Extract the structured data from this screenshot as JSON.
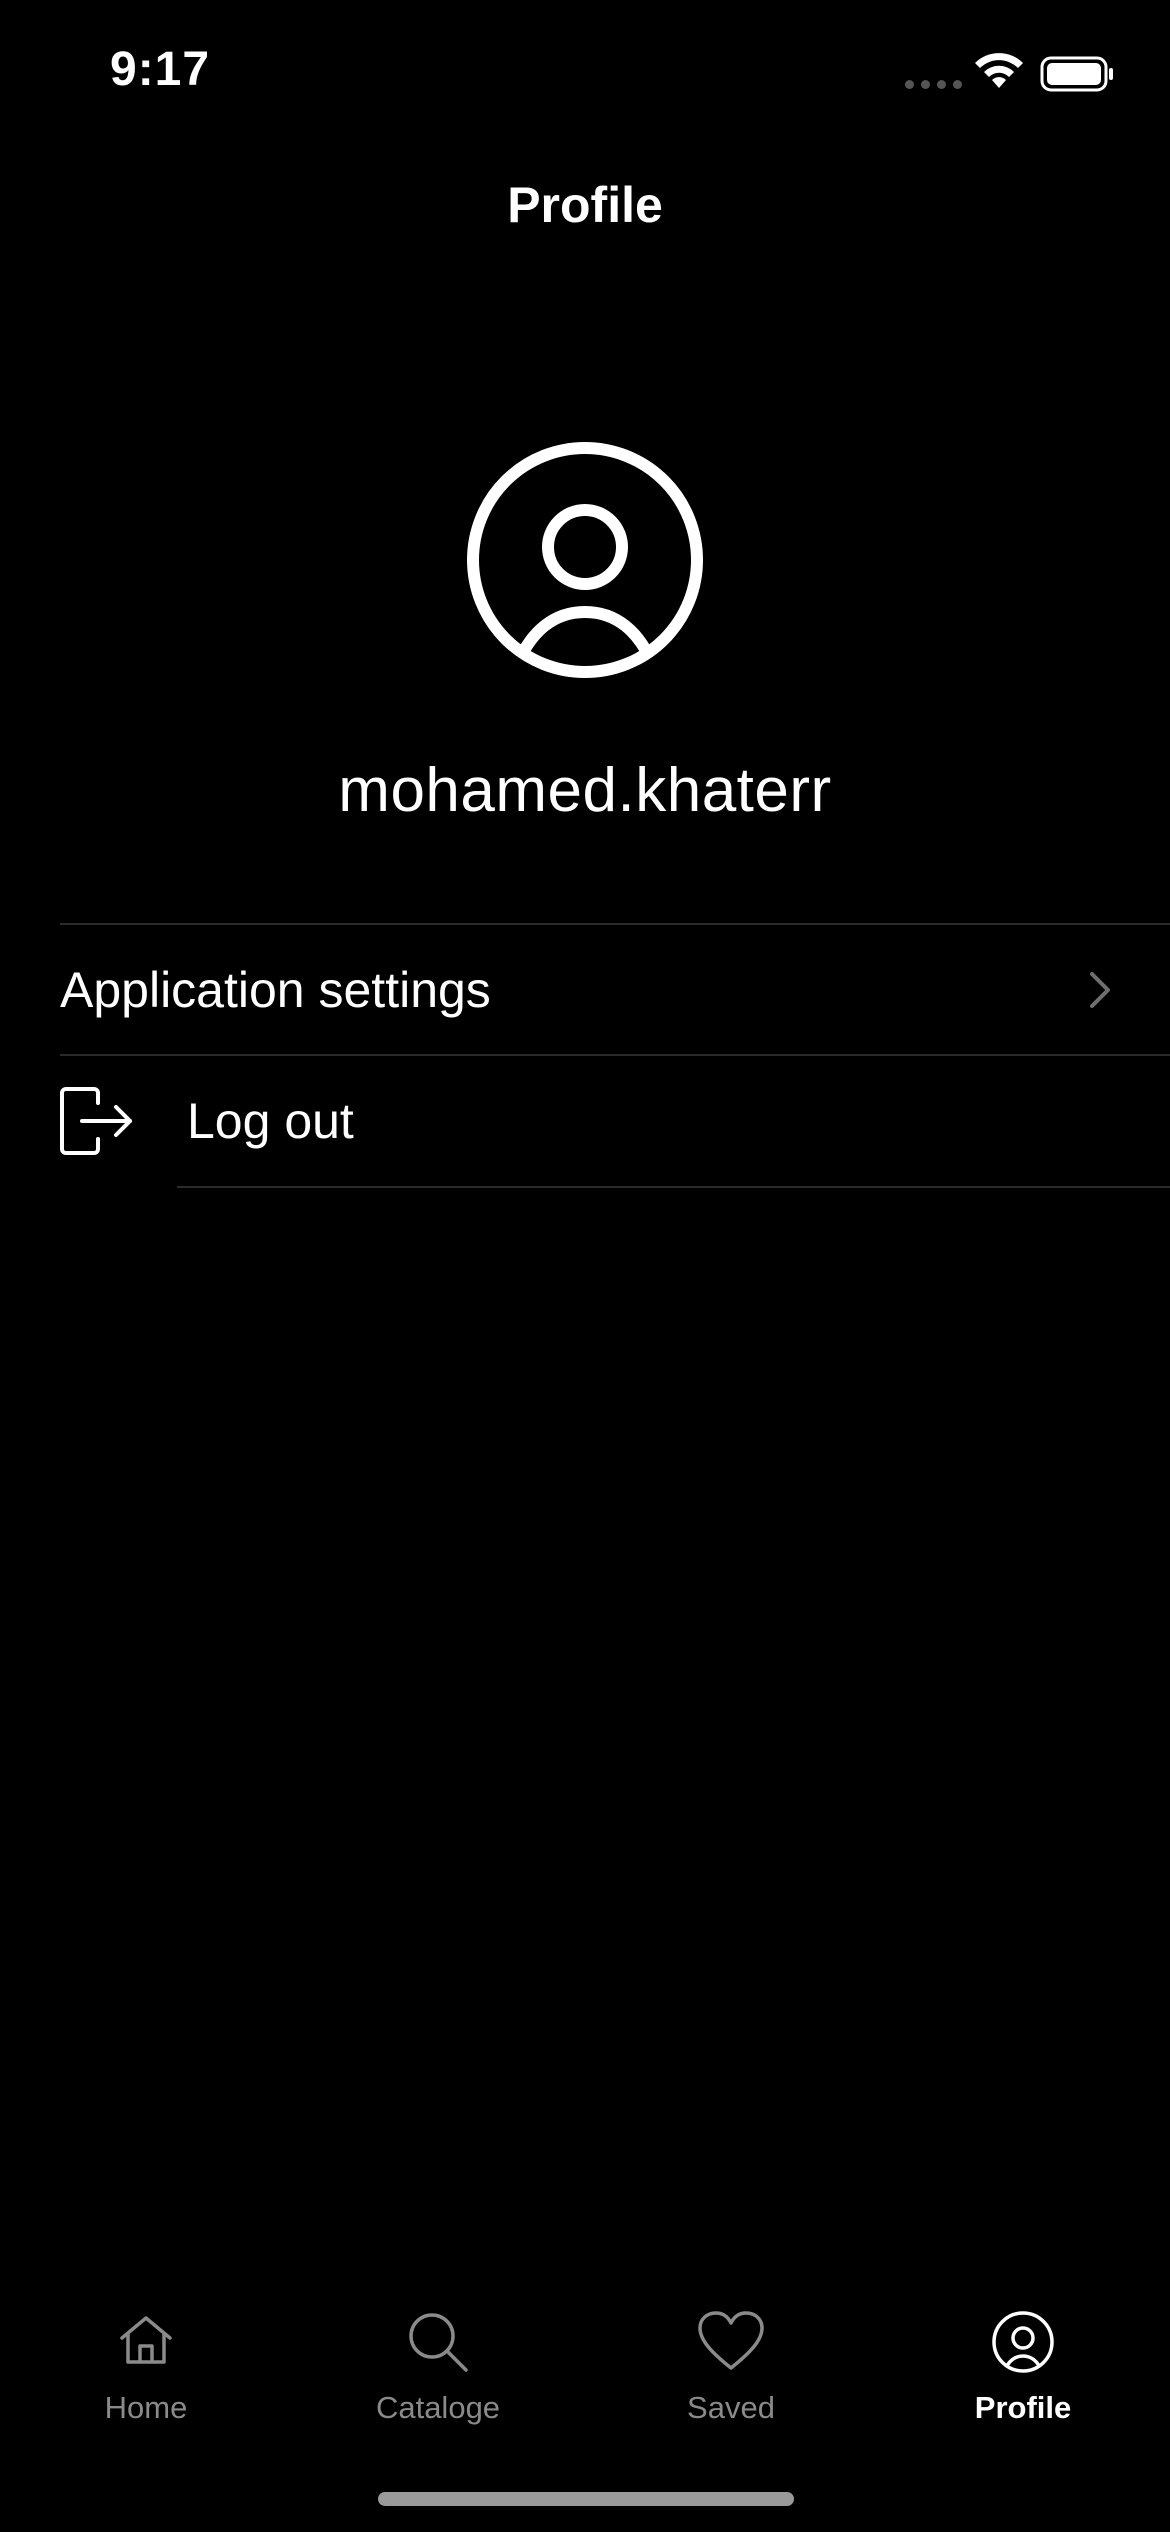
{
  "status_bar": {
    "time": "9:17"
  },
  "header": {
    "title": "Profile"
  },
  "profile": {
    "username": "mohamed.khaterr"
  },
  "menu": [
    {
      "label": "Application settings",
      "icon": "chevron-right-icon"
    },
    {
      "label": "Log out",
      "icon": "logout-icon"
    }
  ],
  "tab_bar": {
    "items": [
      {
        "label": "Home",
        "icon": "home-icon",
        "active": false
      },
      {
        "label": "Cataloge",
        "icon": "search-icon",
        "active": false
      },
      {
        "label": "Saved",
        "icon": "heart-icon",
        "active": false
      },
      {
        "label": "Profile",
        "icon": "profile-icon",
        "active": true
      }
    ]
  },
  "colors": {
    "background": "#000000",
    "text": "#ffffff",
    "inactive_tab": "#8a8a8a",
    "divider": "#2a2a2a"
  }
}
